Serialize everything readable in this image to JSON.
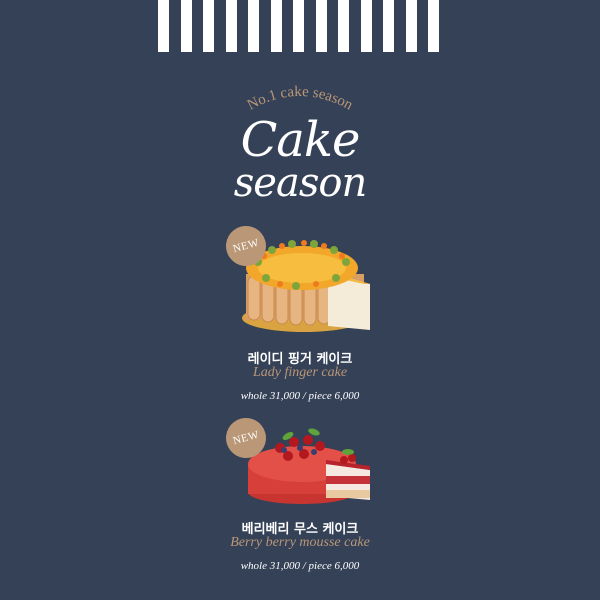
{
  "header": {
    "arc_text": "No.1 cake season",
    "script_line1": "Cake",
    "script_line2": "season"
  },
  "products": [
    {
      "badge": "NEW",
      "name_ko": "레이디 핑거 케이크",
      "name_en": "Lady finger cake",
      "price": "whole 31,000 / piece 6,000"
    },
    {
      "badge": "NEW",
      "name_ko": "베리베리 무스 케이크",
      "name_en": "Berry berry mousse cake",
      "price": "whole 31,000 / piece 6,000"
    }
  ],
  "colors": {
    "background": "#344157",
    "accent": "#b99777",
    "text": "#ffffff"
  }
}
